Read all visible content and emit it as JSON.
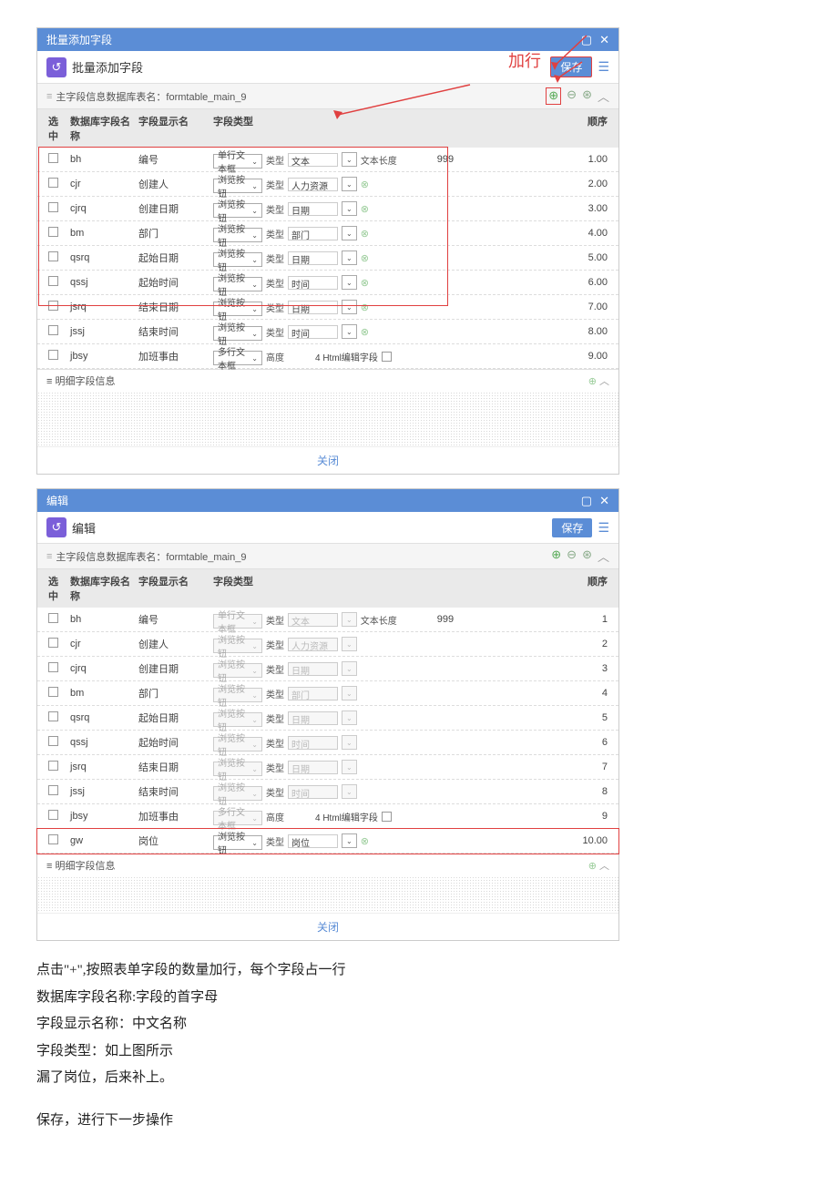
{
  "panel1": {
    "title": "批量添加字段",
    "subtitle": "批量添加字段",
    "save": "保存",
    "info_label": "主字段信息数据库表名：formtable_main_9",
    "annot": "加行",
    "headers": {
      "chk": "选中",
      "db": "数据库字段名称",
      "disp": "字段显示名",
      "type": "字段类型",
      "ord": "顺序"
    },
    "detail": "明细字段信息",
    "rows": [
      {
        "db": "bh",
        "disp": "编号",
        "type": "单行文本框",
        "subLbl": "类型",
        "subVal": "文本",
        "extra": "文本长度",
        "extraVal": "999",
        "ord": "1.00"
      },
      {
        "db": "cjr",
        "disp": "创建人",
        "type": "浏览按钮",
        "subLbl": "类型",
        "subVal": "人力资源",
        "icon": true,
        "ord": "2.00"
      },
      {
        "db": "cjrq",
        "disp": "创建日期",
        "type": "浏览按钮",
        "subLbl": "类型",
        "subVal": "日期",
        "icon": true,
        "ord": "3.00"
      },
      {
        "db": "bm",
        "disp": "部门",
        "type": "浏览按钮",
        "subLbl": "类型",
        "subVal": "部门",
        "icon": true,
        "ord": "4.00"
      },
      {
        "db": "qsrq",
        "disp": "起始日期",
        "type": "浏览按钮",
        "subLbl": "类型",
        "subVal": "日期",
        "icon": true,
        "ord": "5.00"
      },
      {
        "db": "qssj",
        "disp": "起始时间",
        "type": "浏览按钮",
        "subLbl": "类型",
        "subVal": "时间",
        "icon": true,
        "ord": "6.00"
      },
      {
        "db": "jsrq",
        "disp": "结束日期",
        "type": "浏览按钮",
        "subLbl": "类型",
        "subVal": "日期",
        "icon": true,
        "ord": "7.00"
      },
      {
        "db": "jssj",
        "disp": "结束时间",
        "type": "浏览按钮",
        "subLbl": "类型",
        "subVal": "时间",
        "icon": true,
        "ord": "8.00"
      },
      {
        "db": "jbsy",
        "disp": "加班事由",
        "type": "多行文本框",
        "subLbl": "高度",
        "subVal": "",
        "html": "4 Html编辑字段",
        "ord": "9.00"
      }
    ],
    "close": "关闭"
  },
  "panel2": {
    "title": "编辑",
    "subtitle": "编辑",
    "save": "保存",
    "info_label": "主字段信息数据库表名：formtable_main_9",
    "headers": {
      "chk": "选中",
      "db": "数据库字段名称",
      "disp": "字段显示名",
      "type": "字段类型",
      "ord": "顺序"
    },
    "detail": "明细字段信息",
    "rows": [
      {
        "db": "bh",
        "disp": "编号",
        "type": "单行文本框",
        "dis": true,
        "subLbl": "类型",
        "subVal": "文本",
        "subDis": true,
        "extra": "文本长度",
        "extraVal": "999",
        "ord": "1"
      },
      {
        "db": "cjr",
        "disp": "创建人",
        "type": "浏览按钮",
        "dis": true,
        "subLbl": "类型",
        "subVal": "人力资源",
        "subDis": true,
        "ord": "2"
      },
      {
        "db": "cjrq",
        "disp": "创建日期",
        "type": "浏览按钮",
        "dis": true,
        "subLbl": "类型",
        "subVal": "日期",
        "subDis": true,
        "ord": "3"
      },
      {
        "db": "bm",
        "disp": "部门",
        "type": "浏览按钮",
        "dis": true,
        "subLbl": "类型",
        "subVal": "部门",
        "subDis": true,
        "ord": "4"
      },
      {
        "db": "qsrq",
        "disp": "起始日期",
        "type": "浏览按钮",
        "dis": true,
        "subLbl": "类型",
        "subVal": "日期",
        "subDis": true,
        "ord": "5"
      },
      {
        "db": "qssj",
        "disp": "起始时间",
        "type": "浏览按钮",
        "dis": true,
        "subLbl": "类型",
        "subVal": "时间",
        "subDis": true,
        "ord": "6"
      },
      {
        "db": "jsrq",
        "disp": "结束日期",
        "type": "浏览按钮",
        "dis": true,
        "subLbl": "类型",
        "subVal": "日期",
        "subDis": true,
        "ord": "7"
      },
      {
        "db": "jssj",
        "disp": "结束时间",
        "type": "浏览按钮",
        "dis": true,
        "subLbl": "类型",
        "subVal": "时间",
        "subDis": true,
        "ord": "8"
      },
      {
        "db": "jbsy",
        "disp": "加班事由",
        "type": "多行文本框",
        "dis": true,
        "subLbl": "高度",
        "subVal": "",
        "html": "4 Html编辑字段",
        "ord": "9"
      },
      {
        "db": "gw",
        "disp": "岗位",
        "type": "浏览按钮",
        "subLbl": "类型",
        "subVal": "岗位",
        "icon": true,
        "hl": true,
        "ord": "10.00"
      }
    ],
    "close": "关闭"
  },
  "text": {
    "l1": "点击\"+\",按照表单字段的数量加行，每个字段占一行",
    "l2": "数据库字段名称:字段的首字母",
    "l3": "字段显示名称：中文名称",
    "l4": "字段类型：如上图所示",
    "l5": "漏了岗位，后来补上。",
    "l6": "保存，进行下一步操作"
  }
}
